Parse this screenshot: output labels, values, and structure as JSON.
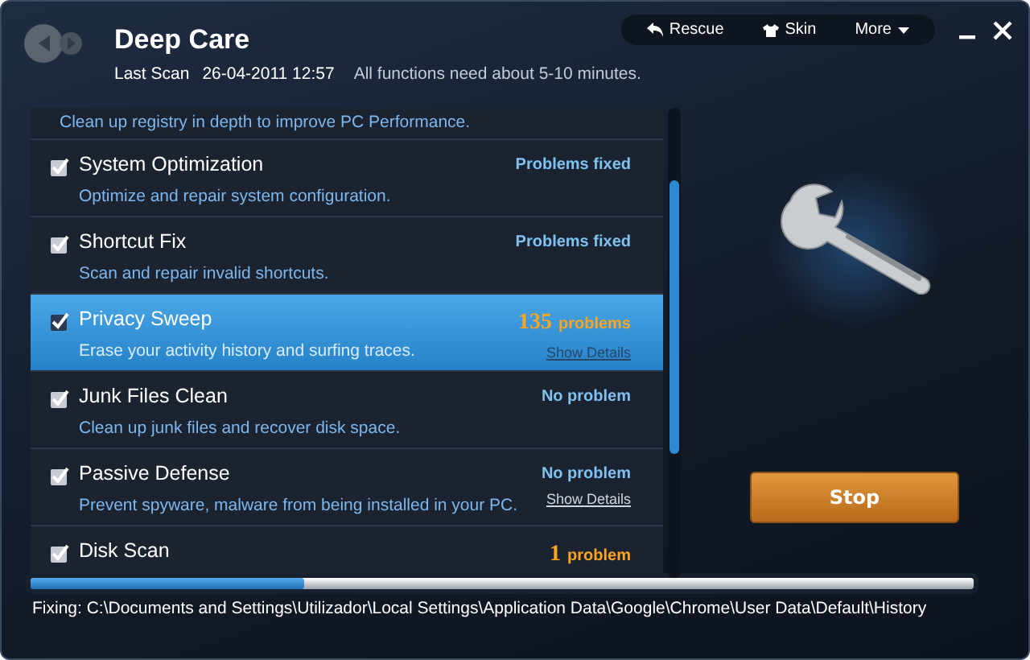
{
  "window": {
    "title": "Deep Care",
    "last_scan_label": "Last Scan",
    "last_scan": "26-04-2011 12:57",
    "hint": "All functions need about 5-10 minutes."
  },
  "toolbar": [
    {
      "label": "Rescue",
      "kind": "rescue"
    },
    {
      "label": "Skin",
      "kind": "skin"
    },
    {
      "label": "More",
      "kind": "more"
    }
  ],
  "items": [
    {
      "description": "Clean up registry in depth to improve PC Performance.",
      "selected": false,
      "kind": "tail"
    },
    {
      "title": "System Optimization",
      "description": "Optimize and repair system configuration.",
      "checked": true,
      "selected": false,
      "kind": "fixed",
      "status": "Problems fixed"
    },
    {
      "title": "Shortcut Fix",
      "description": "Scan and repair invalid shortcuts.",
      "checked": true,
      "selected": false,
      "kind": "fixed",
      "status": "Problems fixed"
    },
    {
      "title": "Privacy Sweep",
      "description": "Erase your activity history and surfing traces.",
      "checked": true,
      "selected": true,
      "kind": "problems",
      "count": "135",
      "status": "problems",
      "details": "Show Details"
    },
    {
      "title": "Junk Files Clean",
      "description": "Clean up junk files and recover disk space.",
      "checked": true,
      "selected": false,
      "kind": "fixed",
      "status": "No problem"
    },
    {
      "title": "Passive Defense",
      "description": "Prevent spyware, malware from being installed in your PC.",
      "checked": true,
      "selected": false,
      "kind": "fixed",
      "status": "No problem",
      "details": "Show Details"
    },
    {
      "title": "Disk Scan",
      "checked": true,
      "selected": false,
      "kind": "problems",
      "count": "1",
      "status": "problem"
    }
  ],
  "stop_button": "Stop",
  "progress": {
    "level": 0.29
  },
  "status": "Fixing: C:\\Documents and Settings\\Utilizador\\Local Settings\\Application Data\\Google\\Chrome\\User Data\\Default\\History"
}
